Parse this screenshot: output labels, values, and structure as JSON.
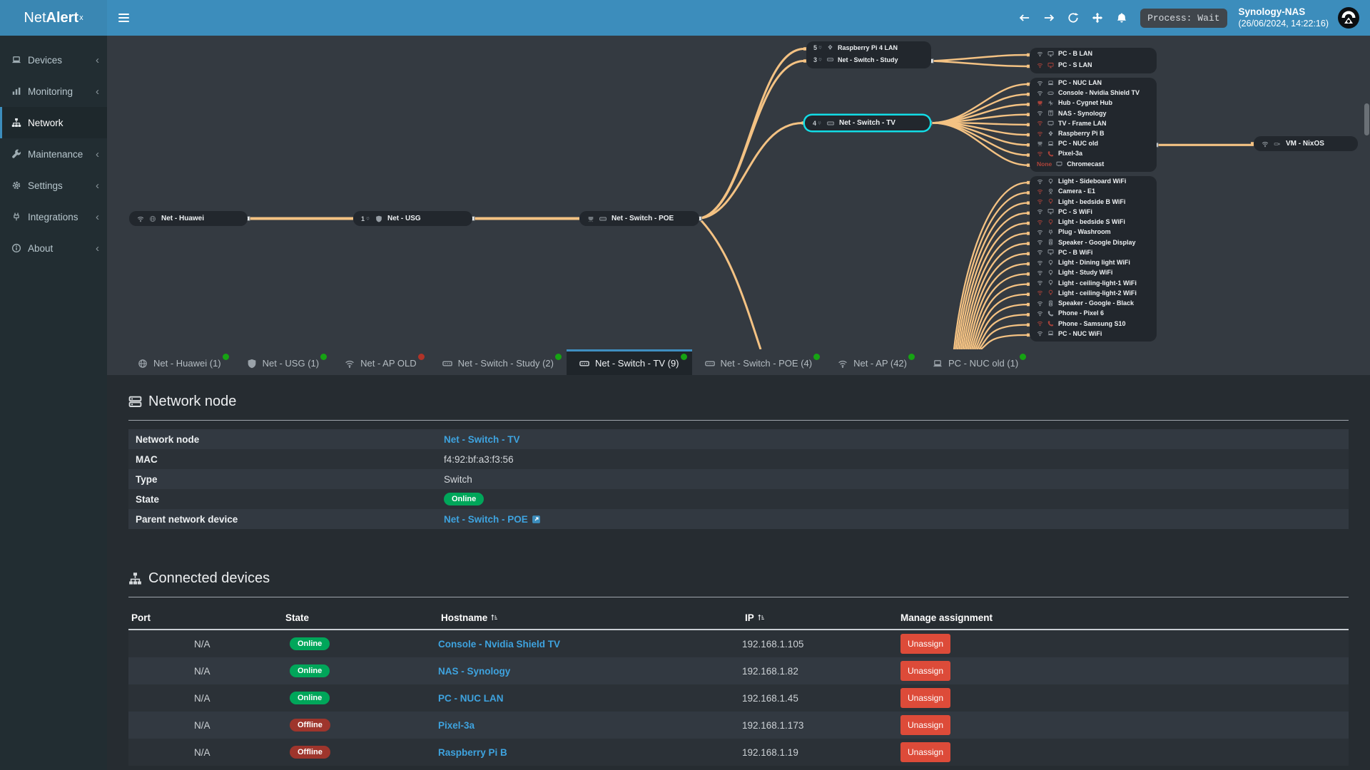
{
  "colors": {
    "navbar": "#3c8dbc",
    "sidebar": "#222d32",
    "canvas": "#343a41",
    "content": "#262c31",
    "edge_orange": "#f4c283",
    "selected_cyan": "#12dde6",
    "link_blue": "#3ea3df",
    "online_green": "#00a65a",
    "offline_red": "#9e352c",
    "danger_red": "#dd4b39",
    "dot_green": "#16a313",
    "dot_red": "#b03328"
  },
  "topbar": {
    "logo": {
      "light": "Net",
      "bold": "Alert",
      "sup": "x"
    },
    "icons": [
      "hamburger-icon",
      "back-arrow-icon",
      "forward-arrow-icon",
      "refresh-icon",
      "move-icon",
      "notifications-bell-icon"
    ],
    "process_status": "Process: Wait",
    "host": "Synology-NAS",
    "datetime": "(26/06/2024, 14:22:16)",
    "avatar": "user-avatar"
  },
  "sidebar": {
    "items": [
      {
        "label": "Devices",
        "icon": "laptop",
        "chevron": "‹",
        "active": false
      },
      {
        "label": "Monitoring",
        "icon": "chart",
        "chevron": "‹",
        "active": false
      },
      {
        "label": "Network",
        "icon": "sitemap",
        "chevron": "",
        "active": true
      },
      {
        "label": "Maintenance",
        "icon": "wrench",
        "chevron": "‹",
        "active": false
      },
      {
        "label": "Settings",
        "icon": "gear",
        "chevron": "‹",
        "active": false
      },
      {
        "label": "Integrations",
        "icon": "powerplug",
        "chevron": "‹",
        "active": false
      },
      {
        "label": "About",
        "icon": "info",
        "chevron": "‹",
        "active": false
      }
    ]
  },
  "topology": {
    "nodes": {
      "huawei": {
        "name": "Net - Huawei",
        "icons": [
          {
            "n": "wifi",
            "c": "grey"
          },
          {
            "n": "globe",
            "c": "dim"
          }
        ]
      },
      "usg": {
        "name": "Net - USG",
        "badge": "1",
        "icons": [
          {
            "n": "shield",
            "c": "grey"
          }
        ]
      },
      "poe": {
        "name": "Net - Switch - POE",
        "icons": [
          {
            "n": "eth",
            "c": "dim"
          },
          {
            "n": "switch",
            "c": "grey"
          }
        ]
      },
      "tv": {
        "name": "Net - Switch - TV",
        "badge": "4",
        "icons": [
          {
            "n": "switch",
            "c": "grey"
          }
        ],
        "selected": true
      },
      "vm": {
        "name": "VM - NixOS",
        "icons": [
          {
            "n": "wifi",
            "c": "grey"
          },
          {
            "n": "dongle",
            "c": "dim"
          }
        ]
      }
    },
    "study_group": [
      {
        "name": "Raspberry Pi 4 LAN",
        "badge": "5",
        "icons": [
          {
            "n": "raspberry",
            "c": "grey"
          }
        ]
      },
      {
        "name": "Net - Switch - Study",
        "badge": "3",
        "icons": [
          {
            "n": "switch",
            "c": "grey"
          }
        ],
        "conn": true
      }
    ],
    "group_bs_lan": [
      {
        "name": "PC - B LAN",
        "icons": [
          {
            "n": "wifi",
            "c": "grey"
          },
          {
            "n": "monitor",
            "c": "grey"
          }
        ]
      },
      {
        "name": "PC - S LAN",
        "icons": [
          {
            "n": "wifi",
            "c": "red"
          },
          {
            "n": "monitor",
            "c": "red"
          }
        ]
      }
    ],
    "group_tv_devices": [
      {
        "name": "PC - NUC LAN",
        "icons": [
          {
            "n": "wifi",
            "c": "grey"
          },
          {
            "n": "laptop",
            "c": "grey"
          }
        ]
      },
      {
        "name": "Console - Nvidia Shield TV",
        "icons": [
          {
            "n": "wifi",
            "c": "grey"
          },
          {
            "n": "gamepad",
            "c": "grey"
          }
        ]
      },
      {
        "name": "Hub - Cygnet Hub",
        "icons": [
          {
            "n": "eth",
            "c": "red"
          },
          {
            "n": "hub",
            "c": "grey"
          }
        ]
      },
      {
        "name": "NAS - Synology",
        "icons": [
          {
            "n": "wifi",
            "c": "grey"
          },
          {
            "n": "nas",
            "c": "grey"
          }
        ]
      },
      {
        "name": "TV - Frame LAN",
        "icons": [
          {
            "n": "wifi",
            "c": "red"
          },
          {
            "n": "tvset",
            "c": "grey"
          }
        ]
      },
      {
        "name": "Raspberry Pi B",
        "icons": [
          {
            "n": "wifi",
            "c": "red"
          },
          {
            "n": "raspberry",
            "c": "grey"
          }
        ]
      },
      {
        "name": "PC - NUC old",
        "icons": [
          {
            "n": "eth",
            "c": "dim"
          },
          {
            "n": "laptop",
            "c": "grey"
          }
        ],
        "conn": true
      },
      {
        "name": "Pixel-3a",
        "icons": [
          {
            "n": "wifi",
            "c": "red"
          },
          {
            "n": "phone",
            "c": "red"
          }
        ]
      },
      {
        "name": "Chromecast",
        "badge": "None",
        "badge_red": true,
        "icons": [
          {
            "n": "tvset",
            "c": "grey"
          }
        ]
      }
    ],
    "group_ap_devices": [
      {
        "name": "Light - Sideboard WiFi",
        "icons": [
          {
            "n": "wifi",
            "c": "grey"
          },
          {
            "n": "bulb",
            "c": "grey"
          }
        ]
      },
      {
        "name": "Camera - E1",
        "icons": [
          {
            "n": "wifi",
            "c": "red"
          },
          {
            "n": "camera",
            "c": "grey"
          }
        ]
      },
      {
        "name": "Light - bedside B WiFi",
        "icons": [
          {
            "n": "wifi",
            "c": "red"
          },
          {
            "n": "bulb",
            "c": "red"
          }
        ]
      },
      {
        "name": "PC - S WiFi",
        "icons": [
          {
            "n": "wifi",
            "c": "grey"
          },
          {
            "n": "monitor",
            "c": "grey"
          }
        ]
      },
      {
        "name": "Light - bedside S WiFi",
        "icons": [
          {
            "n": "wifi",
            "c": "red"
          },
          {
            "n": "bulb",
            "c": "red"
          }
        ]
      },
      {
        "name": "Plug - Washroom",
        "icons": [
          {
            "n": "wifi",
            "c": "grey"
          },
          {
            "n": "powerplug",
            "c": "grey"
          }
        ]
      },
      {
        "name": "Speaker - Google Display",
        "icons": [
          {
            "n": "wifi",
            "c": "grey"
          },
          {
            "n": "speaker",
            "c": "grey"
          }
        ]
      },
      {
        "name": "PC - B WiFi",
        "icons": [
          {
            "n": "wifi",
            "c": "grey"
          },
          {
            "n": "monitor",
            "c": "grey"
          }
        ]
      },
      {
        "name": "Light - Dining light WiFi",
        "icons": [
          {
            "n": "wifi",
            "c": "grey"
          },
          {
            "n": "bulb",
            "c": "grey"
          }
        ]
      },
      {
        "name": "Light - Study WiFi",
        "icons": [
          {
            "n": "wifi",
            "c": "grey"
          },
          {
            "n": "bulb",
            "c": "grey"
          }
        ]
      },
      {
        "name": "Light - ceiling-light-1 WiFi",
        "icons": [
          {
            "n": "wifi",
            "c": "grey"
          },
          {
            "n": "bulb",
            "c": "grey"
          }
        ]
      },
      {
        "name": "Light - ceiling-light-2 WiFi",
        "icons": [
          {
            "n": "wifi",
            "c": "red"
          },
          {
            "n": "bulb",
            "c": "red"
          }
        ]
      },
      {
        "name": "Speaker - Google - Black",
        "icons": [
          {
            "n": "wifi",
            "c": "grey"
          },
          {
            "n": "speaker",
            "c": "grey"
          }
        ]
      },
      {
        "name": "Phone - Pixel 6",
        "icons": [
          {
            "n": "wifi",
            "c": "grey"
          },
          {
            "n": "phone",
            "c": "grey"
          }
        ]
      },
      {
        "name": "Phone - Samsung S10",
        "icons": [
          {
            "n": "wifi",
            "c": "red"
          },
          {
            "n": "phone",
            "c": "red"
          }
        ]
      },
      {
        "name": "PC - NUC WiFi",
        "icons": [
          {
            "n": "wifi",
            "c": "grey"
          },
          {
            "n": "laptop",
            "c": "grey"
          }
        ]
      }
    ]
  },
  "tabs": [
    {
      "label": "Net - Huawei (1)",
      "icon": "globe",
      "dot": "green",
      "active": false
    },
    {
      "label": "Net - USG (1)",
      "icon": "shield",
      "dot": "green",
      "active": false
    },
    {
      "label": "Net - AP OLD",
      "icon": "wifi",
      "dot": "red",
      "active": false
    },
    {
      "label": "Net - Switch - Study (2)",
      "icon": "switch",
      "dot": "green",
      "active": false
    },
    {
      "label": "Net - Switch - TV (9)",
      "icon": "switch",
      "dot": "green",
      "active": true
    },
    {
      "label": "Net - Switch - POE (4)",
      "icon": "switch",
      "dot": "green",
      "active": false
    },
    {
      "label": "Net - AP (42)",
      "icon": "wifi",
      "dot": "green",
      "active": false
    },
    {
      "label": "PC - NUC old (1)",
      "icon": "laptop",
      "dot": "green",
      "active": false
    }
  ],
  "network_node": {
    "title": "Network node",
    "rows": [
      {
        "label": "Network node",
        "value": "Net - Switch - TV",
        "type": "link"
      },
      {
        "label": "MAC",
        "value": "f4:92:bf:a3:f3:56",
        "type": "text"
      },
      {
        "label": "Type",
        "value": "Switch",
        "type": "text"
      },
      {
        "label": "State",
        "value": "Online",
        "type": "badge-online"
      },
      {
        "label": "Parent network device",
        "value": "Net - Switch - POE",
        "type": "link-ext"
      }
    ]
  },
  "connected": {
    "title": "Connected devices",
    "columns": [
      "Port",
      "State",
      "Hostname",
      "IP",
      "Manage assignment"
    ],
    "rows": [
      {
        "port": "N/A",
        "state": "Online",
        "hostname": "Console - Nvidia Shield TV",
        "ip": "192.168.1.105",
        "action": "Unassign"
      },
      {
        "port": "N/A",
        "state": "Online",
        "hostname": "NAS - Synology",
        "ip": "192.168.1.82",
        "action": "Unassign"
      },
      {
        "port": "N/A",
        "state": "Online",
        "hostname": "PC - NUC LAN",
        "ip": "192.168.1.45",
        "action": "Unassign"
      },
      {
        "port": "N/A",
        "state": "Offline",
        "hostname": "Pixel-3a",
        "ip": "192.168.1.173",
        "action": "Unassign"
      },
      {
        "port": "N/A",
        "state": "Offline",
        "hostname": "Raspberry Pi B",
        "ip": "192.168.1.19",
        "action": "Unassign"
      }
    ]
  }
}
